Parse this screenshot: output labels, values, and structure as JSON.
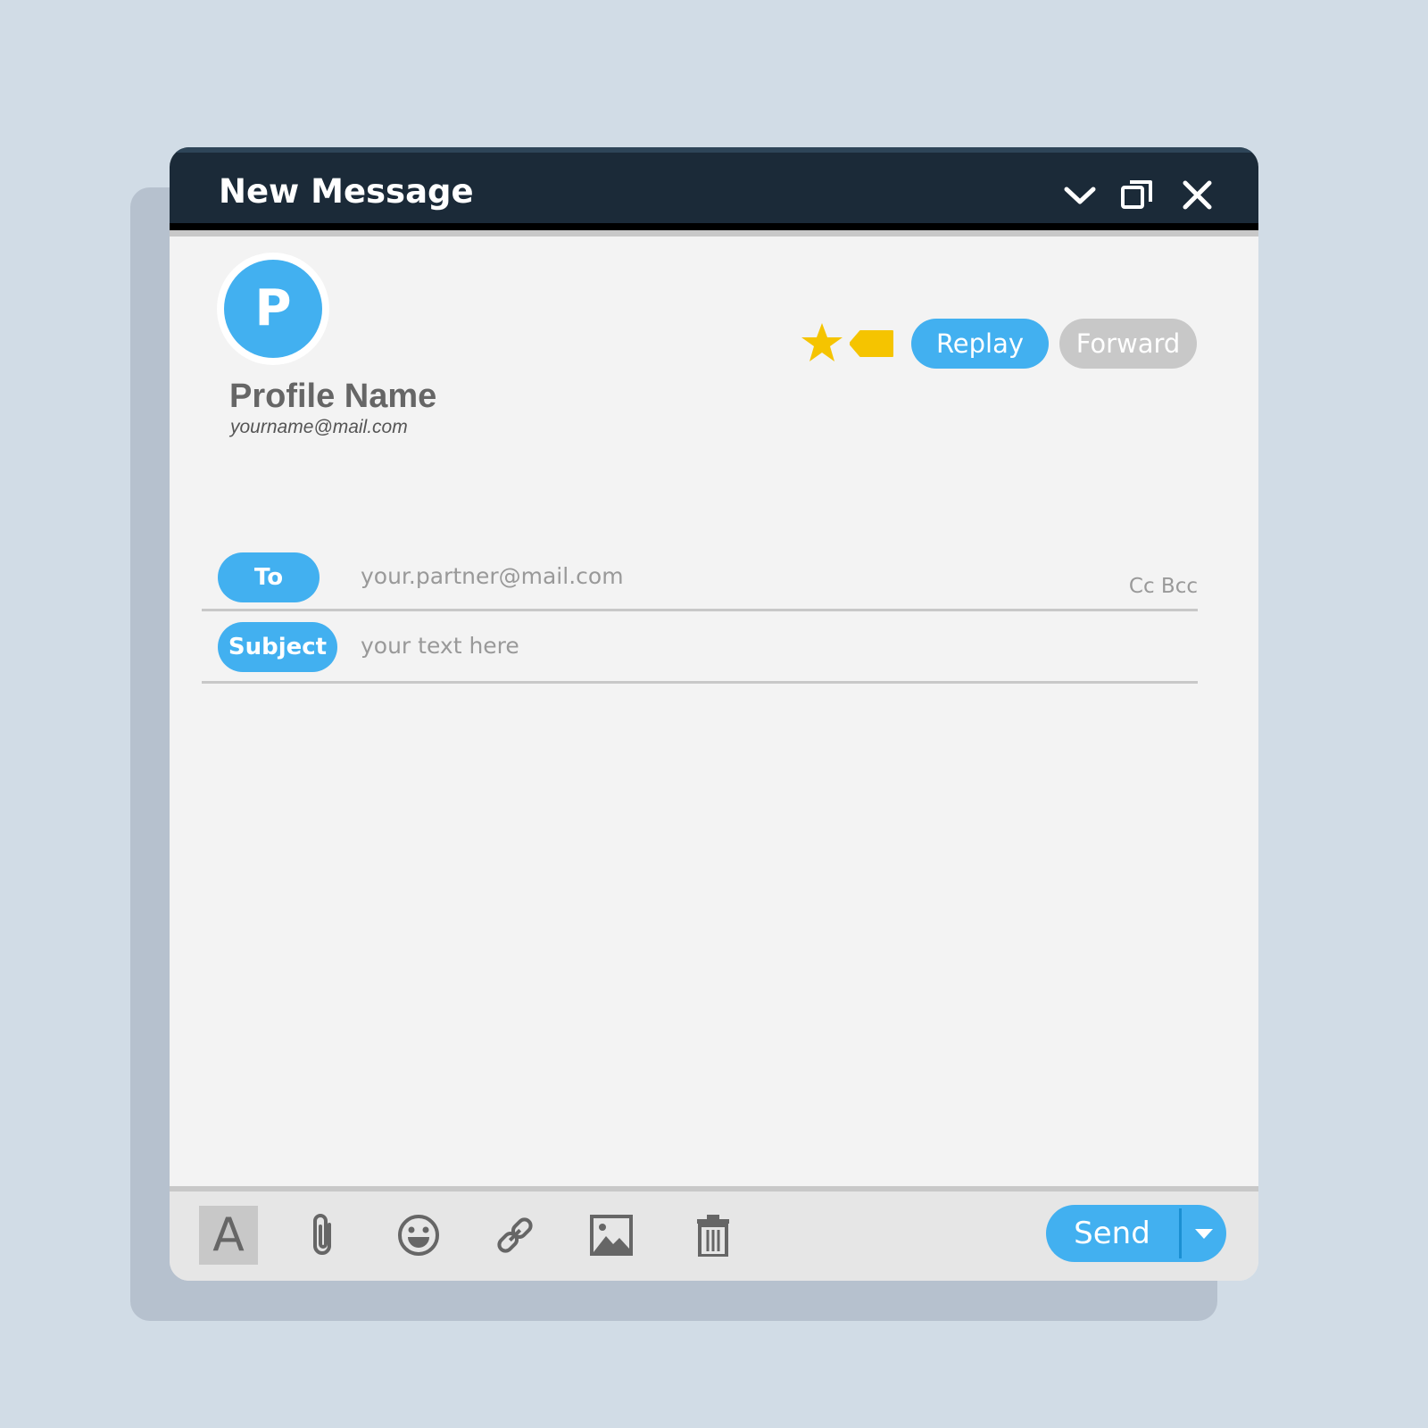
{
  "window": {
    "title": "New Message",
    "controls": {
      "minimize_icon": "chevron-down-icon",
      "restore_icon": "restore-window-icon",
      "close_icon": "close-icon"
    }
  },
  "profile": {
    "avatar_letter": "P",
    "name": "Profile Name",
    "email": "yourname@mail.com"
  },
  "actions": {
    "star_icon": "star-icon",
    "tag_icon": "tag-icon",
    "replay_label": "Replay",
    "forward_label": "Forward"
  },
  "compose": {
    "to_label": "To",
    "to_placeholder": "your.partner@mail.com",
    "cc_bcc_label": "Cc Bcc",
    "subject_label": "Subject",
    "subject_placeholder": "your text here"
  },
  "toolbar": {
    "format_label": "A",
    "tools": [
      "text-format-icon",
      "paperclip-icon",
      "emoji-icon",
      "link-icon",
      "image-icon",
      "trash-icon"
    ],
    "send_label": "Send"
  },
  "colors": {
    "background": "#d1dce6",
    "titlebar": "#1b2a38",
    "accent": "#42b0f0",
    "star": "#f5c400",
    "muted_button": "#c8c8c8"
  }
}
